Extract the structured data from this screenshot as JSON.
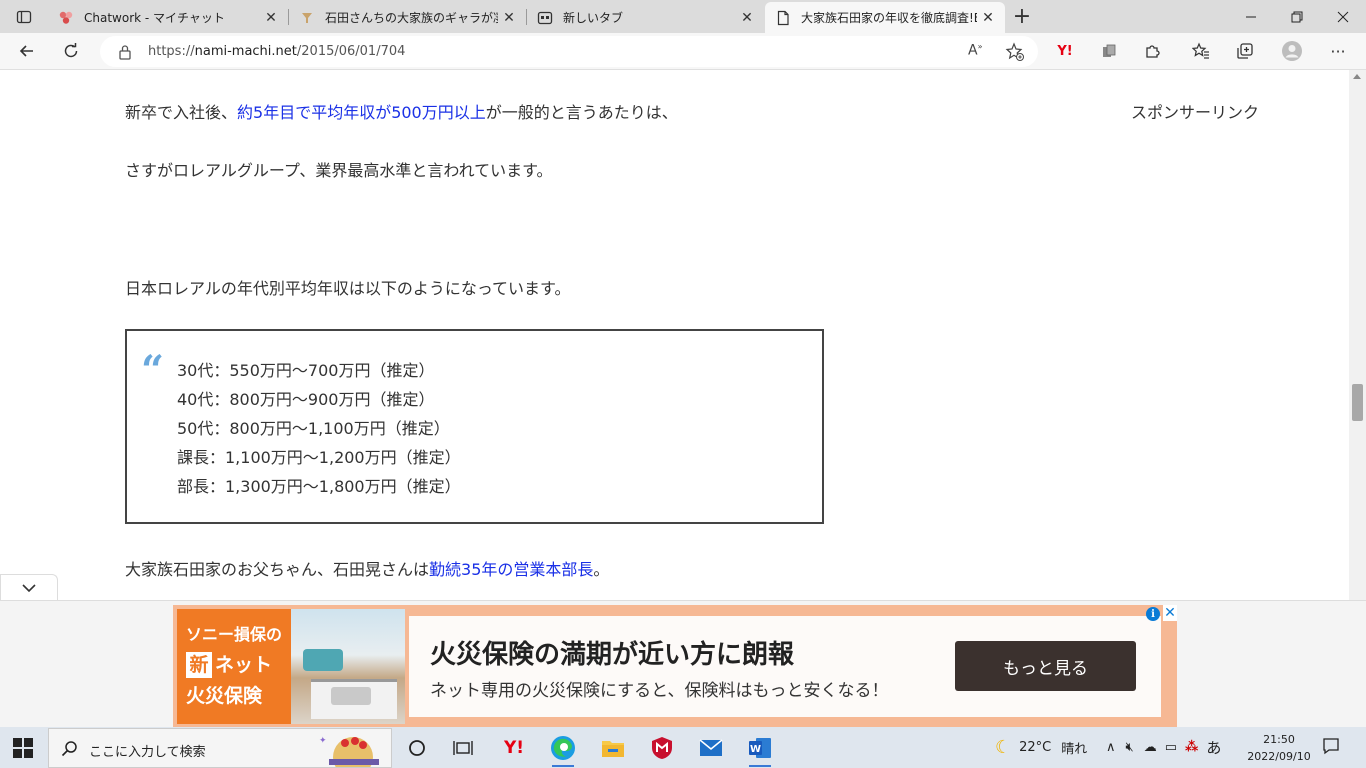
{
  "browser": {
    "tabs": [
      {
        "title": "Chatwork - マイチャット",
        "icon": "chatwork-icon",
        "active": false
      },
      {
        "title": "石田さんちの大家族のギャラが凄い？",
        "icon": "site-favicon",
        "active": false
      },
      {
        "title": "新しいタブ",
        "icon": "newtab-page-icon",
        "active": false
      },
      {
        "title": "大家族石田家の年収を徹底調査!Ε",
        "icon": "page-icon",
        "active": true
      }
    ],
    "url_prefix": "https://",
    "url_host": "nami-machi.net",
    "url_path": "/2015/06/01/704",
    "yahoo_label": "Y!"
  },
  "article": {
    "para1_pre": "新卒で入社後、",
    "para1_link": "約5年目で平均年収が500万円以上",
    "para1_post": "が一般的と言うあたりは、",
    "para2": "さすがロレアルグループ、業界最高水準と言われています。",
    "para3": "日本ロレアルの年代別平均年収は以下のようになっています。",
    "quote_lines": [
      "30代：550万円〜700万円（推定）",
      "40代：800万円〜900万円（推定）",
      "50代：800万円〜1,100万円（推定）",
      "課長：1,100万円〜1,200万円（推定）",
      "部長：1,300万円〜1,800万円（推定）"
    ],
    "para4_pre": "大家族石田家のお父ちゃん、石田晃さんは",
    "para4_link": "勤続35年の営業本部長",
    "para4_post": "。",
    "sidebar_label": "スポンサーリンク"
  },
  "ad": {
    "logo_line1": "ソニー損保の",
    "logo_new": "新",
    "logo_line2": "ネット",
    "logo_line3": "火災保険",
    "headline": "火災保険の満期が近い方に朗報",
    "subline": "ネット専用の火災保険にすると、保険料はもっと安くなる！",
    "cta": "もっと見る",
    "info": "i",
    "close": "✕"
  },
  "taskbar": {
    "search_placeholder": "ここに入力して検索",
    "yahoo_label": "Y!",
    "weather_temp": "22°C",
    "weather_text": "晴れ",
    "ime": "あ",
    "time": "21:50",
    "date": "2022/09/10"
  }
}
